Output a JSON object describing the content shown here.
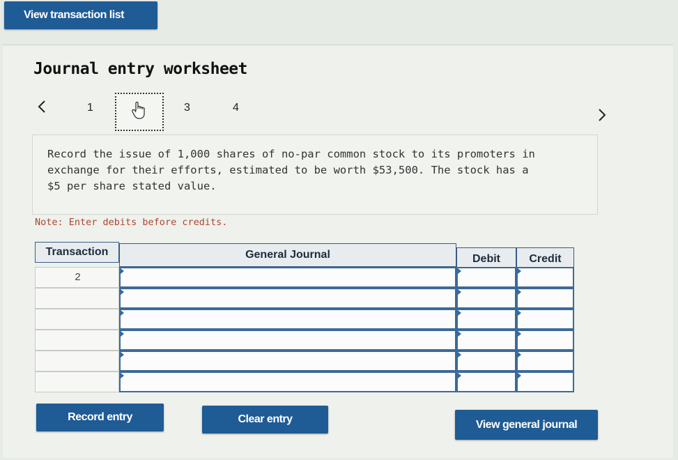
{
  "top_button": {
    "label": "View transaction list"
  },
  "title": "Journal entry worksheet",
  "navigation": {
    "prev_icon": "chevron-left-icon",
    "next_icon": "chevron-right-icon",
    "steps": [
      "1",
      "3",
      "4"
    ],
    "current_step_icon": "pointer-hand-icon"
  },
  "instruction": "Record the issue of 1,000 shares of no-par common stock to its promoters in exchange for their efforts, estimated to be worth $53,500. The stock has a $5 per share stated value.",
  "note": "Note: Enter debits before credits.",
  "journal": {
    "headers": {
      "transaction": "Transaction",
      "general_journal": "General Journal",
      "debit": "Debit",
      "credit": "Credit"
    },
    "rows": [
      {
        "transaction": "2",
        "account": "",
        "debit": "",
        "credit": ""
      },
      {
        "transaction": "",
        "account": "",
        "debit": "",
        "credit": ""
      },
      {
        "transaction": "",
        "account": "",
        "debit": "",
        "credit": ""
      },
      {
        "transaction": "",
        "account": "",
        "debit": "",
        "credit": ""
      },
      {
        "transaction": "",
        "account": "",
        "debit": "",
        "credit": ""
      },
      {
        "transaction": "",
        "account": "",
        "debit": "",
        "credit": ""
      }
    ]
  },
  "buttons": {
    "record": "Record entry",
    "clear": "Clear entry",
    "view_general_journal": "View general journal"
  },
  "colors": {
    "button_blue": "#1f5b95",
    "note_red": "#b0452e",
    "cell_border_blue": "#3c6a98"
  }
}
